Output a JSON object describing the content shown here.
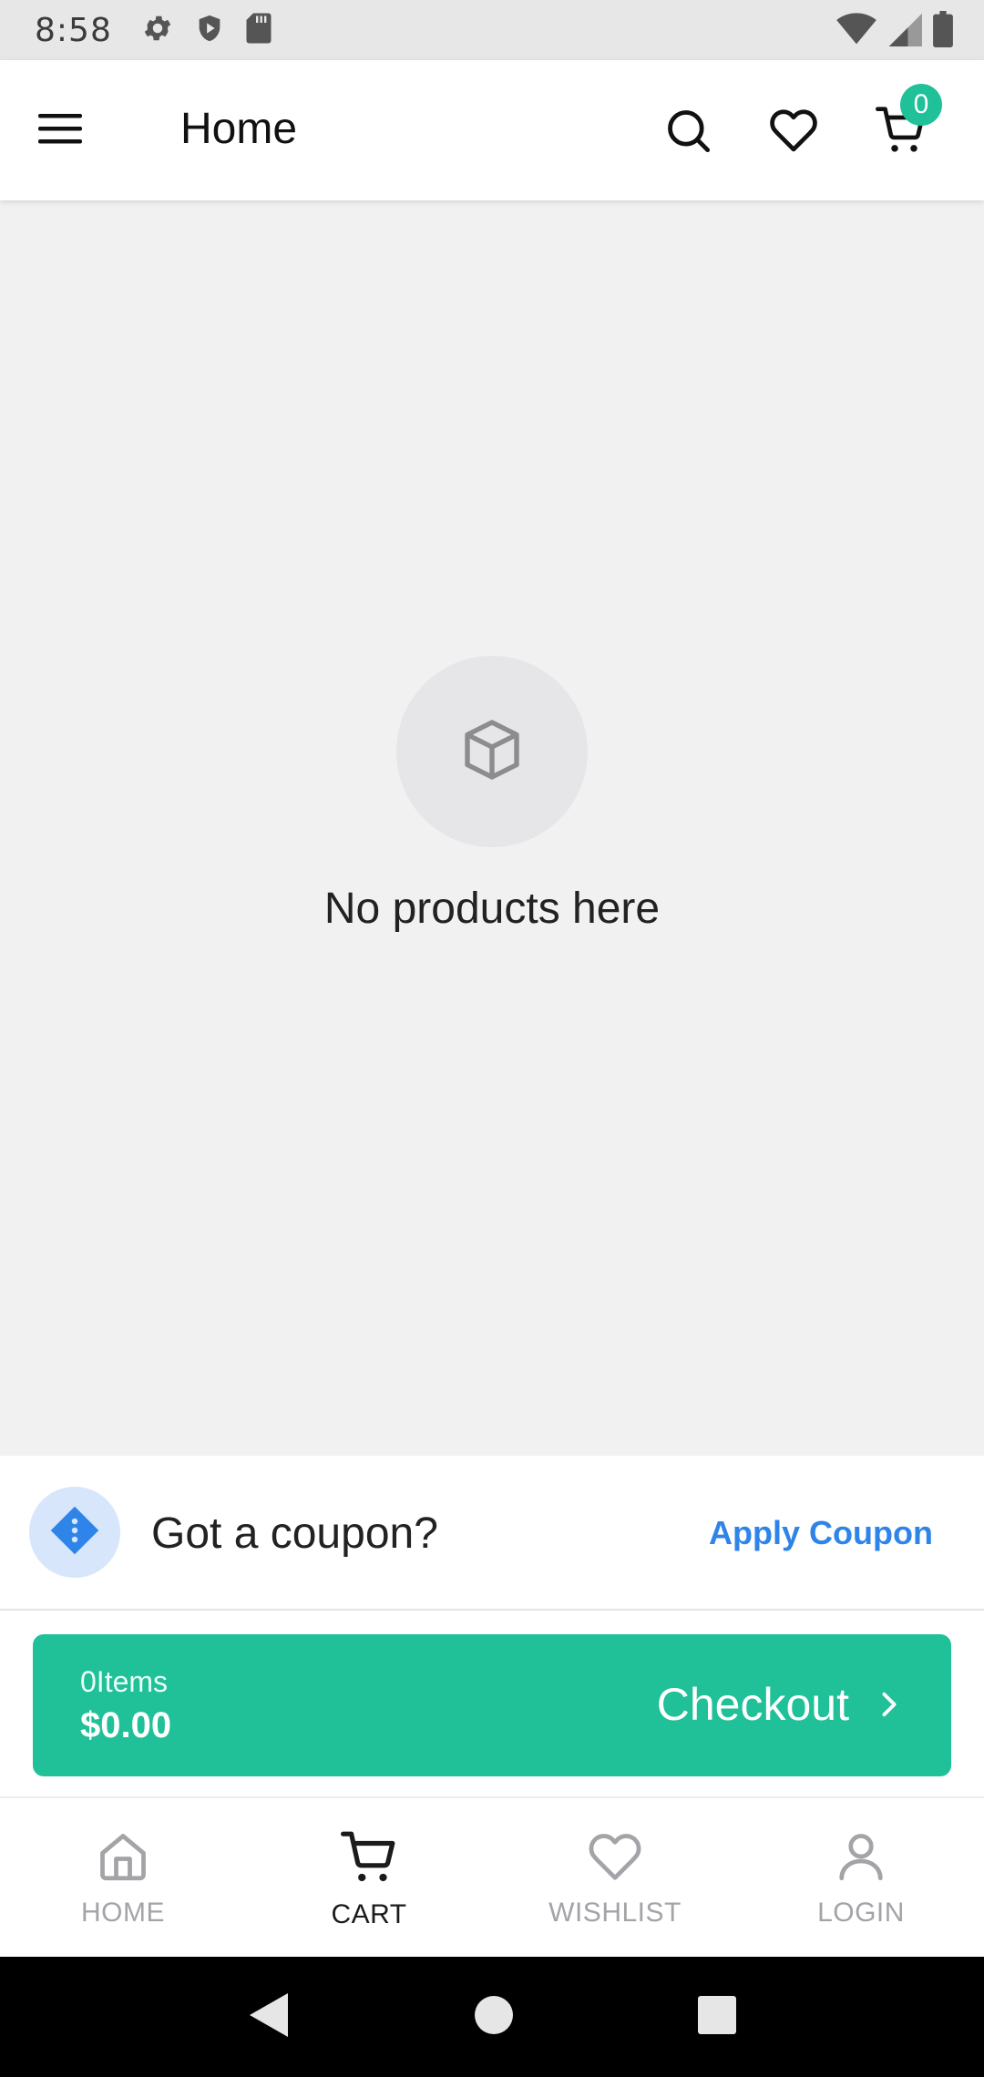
{
  "status_bar": {
    "time": "8:58",
    "left_icons": [
      "gear-icon",
      "shield-play-icon",
      "sd-card-icon"
    ],
    "right_icons": [
      "wifi-icon",
      "signal-icon",
      "battery-icon"
    ]
  },
  "app_bar": {
    "title": "Home",
    "cart_count": "0",
    "icons": [
      "menu-icon",
      "search-icon",
      "heart-icon",
      "cart-icon"
    ]
  },
  "empty_state": {
    "icon": "box-icon",
    "message": "No products here"
  },
  "coupon": {
    "icon": "coupon-tag-icon",
    "prompt": "Got a coupon?",
    "action": "Apply Coupon"
  },
  "checkout": {
    "items_text": "0Items",
    "total": "$0.00",
    "label": "Checkout",
    "icon": "chevron-right-icon"
  },
  "bottom_nav": {
    "items": [
      {
        "label": "HOME",
        "icon": "home-icon",
        "active": false
      },
      {
        "label": "CART",
        "icon": "cart-icon",
        "active": true
      },
      {
        "label": "WISHLIST",
        "icon": "heart-icon",
        "active": false
      },
      {
        "label": "LOGIN",
        "icon": "user-icon",
        "active": false
      }
    ]
  },
  "system_nav": [
    "back-icon",
    "home-circle-icon",
    "recents-icon"
  ],
  "colors": {
    "accent": "#20c098",
    "link": "#2e84e8",
    "inactive": "#a3a3a8",
    "background": "#f1f1f2"
  }
}
